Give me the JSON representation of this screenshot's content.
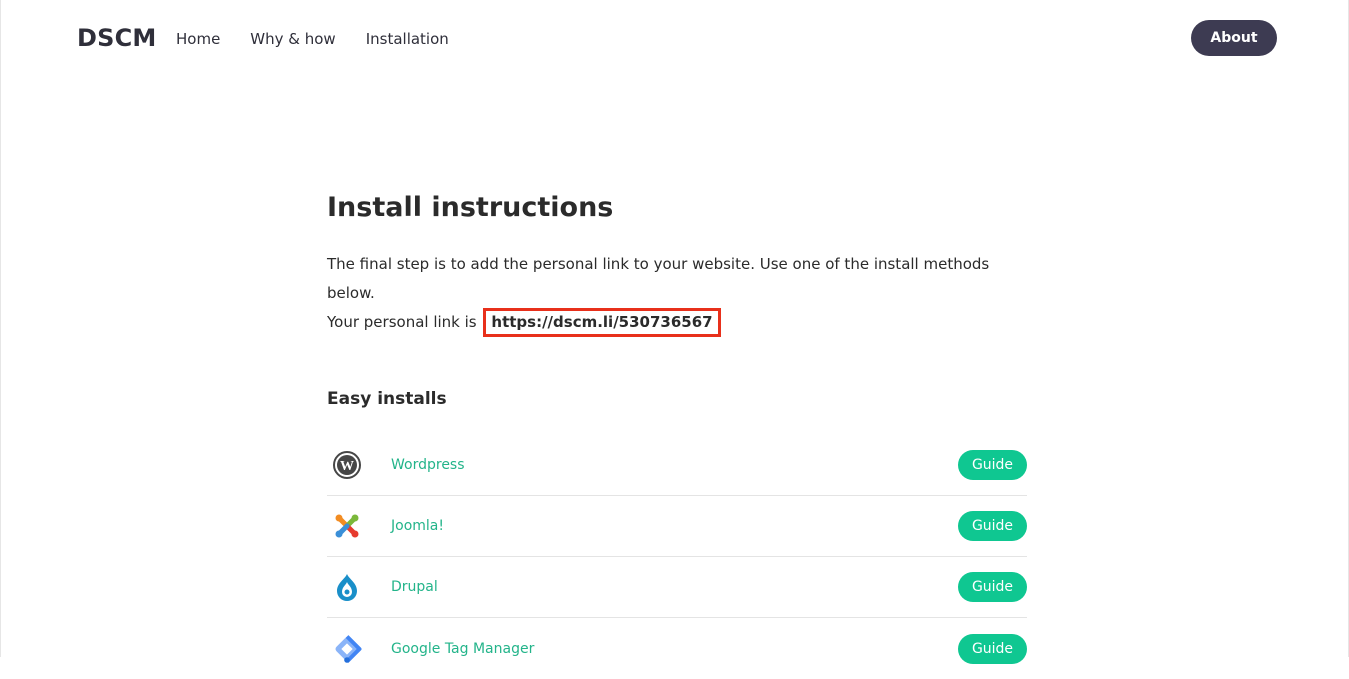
{
  "header": {
    "brand": "DSCM",
    "nav": [
      "Home",
      "Why & how",
      "Installation"
    ],
    "about_label": "About"
  },
  "main": {
    "title": "Install instructions",
    "line1": "The final step is to add the personal link to your website. Use one of the install methods below.",
    "line2_prefix": "Your personal link is",
    "personal_link": "https://dscm.li/530736567",
    "section_title": "Easy installs",
    "installs": [
      {
        "name": "Wordpress",
        "icon": "wordpress-icon",
        "button": "Guide"
      },
      {
        "name": "Joomla!",
        "icon": "joomla-icon",
        "button": "Guide"
      },
      {
        "name": "Drupal",
        "icon": "drupal-icon",
        "button": "Guide"
      },
      {
        "name": "Google Tag Manager",
        "icon": "google-tag-manager-icon",
        "button": "Guide"
      }
    ]
  },
  "colors": {
    "about_button": "#3d3b52",
    "guide_button": "#0fc791",
    "link_green": "#23b48a",
    "highlight_red": "#e8301b"
  }
}
